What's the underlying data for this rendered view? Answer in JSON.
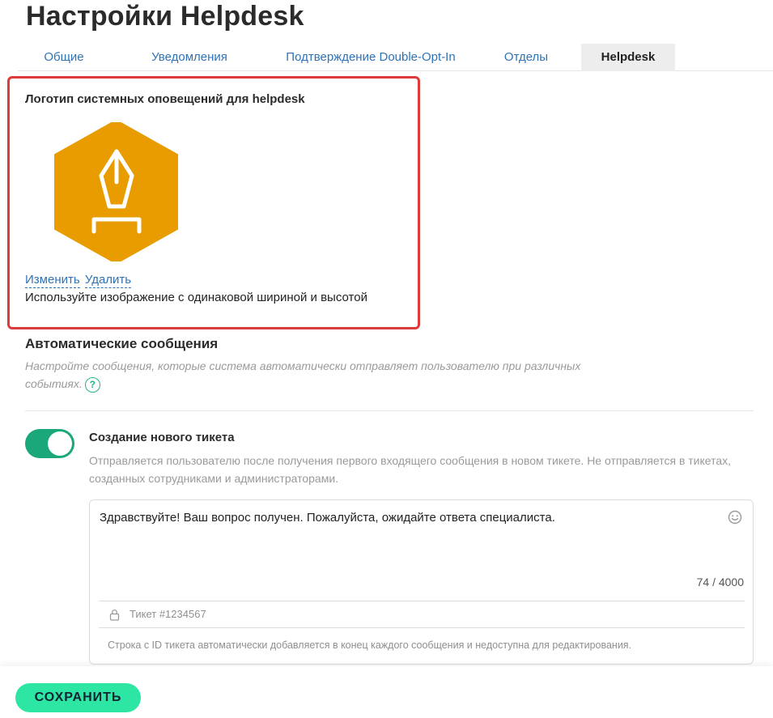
{
  "page": {
    "title": "Настройки Helpdesk"
  },
  "tabs": [
    {
      "label": "Общие"
    },
    {
      "label": "Уведомления"
    },
    {
      "label": "Подтверждение Double-Opt-In"
    },
    {
      "label": "Отделы"
    },
    {
      "label": "Helpdesk",
      "active": true
    }
  ],
  "logo_section": {
    "title": "Логотип системных оповещений для helpdesk",
    "change_label": "Изменить",
    "delete_label": "Удалить",
    "hint": "Используйте изображение с одинаковой шириной и высотой",
    "logo_color": "#e89c00",
    "logo_icon": "pen-nib-icon"
  },
  "auto_messages": {
    "title": "Автоматические сообщения",
    "description": "Настройте сообщения, которые система автоматически отправляет пользователю при различных событиях.",
    "help": "?"
  },
  "new_ticket": {
    "enabled": true,
    "title": "Создание нового тикета",
    "description": "Отправляется пользователю после получения первого входящего сообщения в новом тикете. Не отправляется в тикетах, созданных сотрудниками и администраторами.",
    "message": "Здравствуйте! Ваш вопрос получен. Пожалуйста, ожидайте ответа специалиста.",
    "counter": "74 / 4000",
    "ticket_id": "Тикет #1234567",
    "note": "Строка с ID тикета автоматически добавляется в конец каждого сообщения и недоступна для редактирования."
  },
  "footer": {
    "save_label": "СОХРАНИТЬ"
  },
  "colors": {
    "accent": "#2f73b7",
    "toggle": "#1aa77a",
    "save": "#2ee6a4",
    "highlight": "#de3b3b"
  }
}
